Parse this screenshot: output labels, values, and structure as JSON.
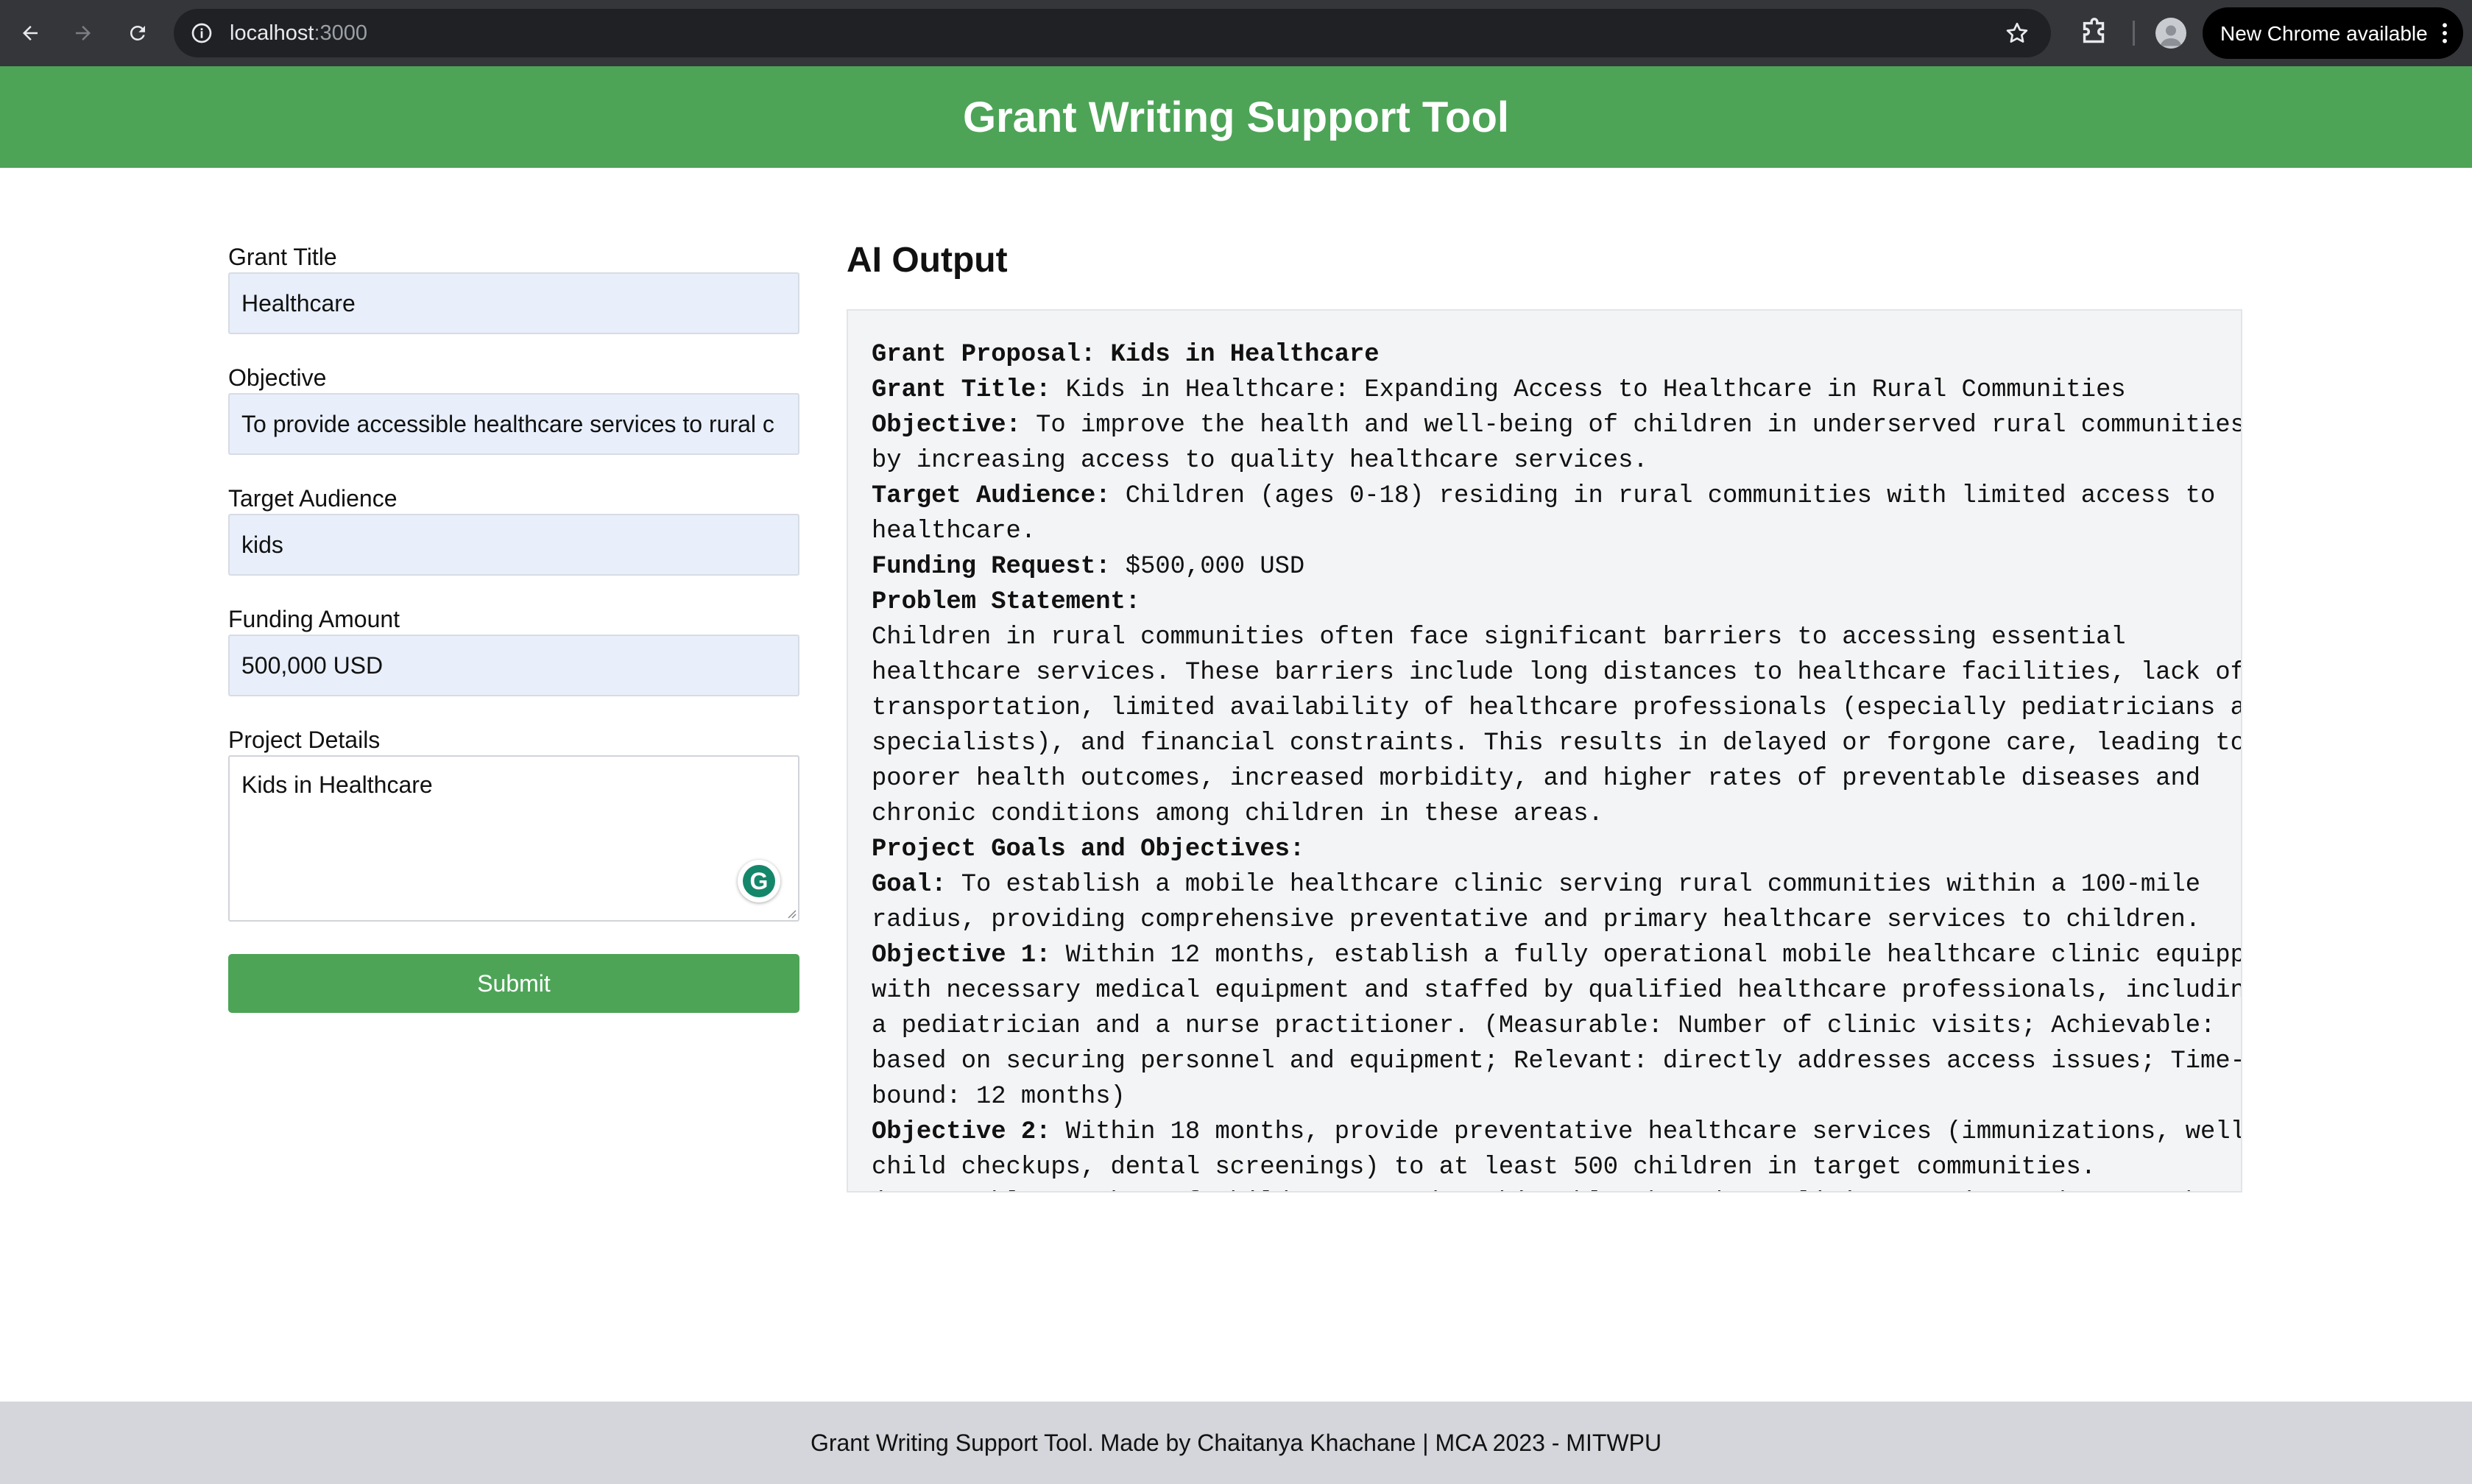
{
  "browser": {
    "url_host": "localhost",
    "url_port": ":3000",
    "update_label": "New Chrome available"
  },
  "header": {
    "title": "Grant Writing Support Tool"
  },
  "form": {
    "grant_title_label": "Grant Title",
    "grant_title_value": "Healthcare",
    "objective_label": "Objective",
    "objective_value": "To provide accessible healthcare services to rural c",
    "target_audience_label": "Target Audience",
    "target_audience_value": "kids",
    "funding_amount_label": "Funding Amount",
    "funding_amount_value": "500,000 USD",
    "project_details_label": "Project Details",
    "project_details_value": "Kids in Healthcare",
    "grammarly_glyph": "G",
    "submit_label": "Submit"
  },
  "output": {
    "title": "AI Output",
    "lines": [
      {
        "bold": "Grant Proposal: Kids in Healthcare",
        "text": ""
      },
      {
        "bold": "Grant Title:",
        "text": " Kids in Healthcare: Expanding Access to Healthcare in Rural Communities"
      },
      {
        "bold": "Objective:",
        "text": " To improve the health and well-being of children in underserved rural communities"
      },
      {
        "bold": "",
        "text": "by increasing access to quality healthcare services."
      },
      {
        "bold": "Target Audience:",
        "text": " Children (ages 0-18) residing in rural communities with limited access to"
      },
      {
        "bold": "",
        "text": "healthcare."
      },
      {
        "bold": "Funding Request:",
        "text": " $500,000 USD"
      },
      {
        "bold": "Problem Statement:",
        "text": ""
      },
      {
        "bold": "",
        "text": "Children in rural communities often face significant barriers to accessing essential"
      },
      {
        "bold": "",
        "text": "healthcare services. These barriers include long distances to healthcare facilities, lack of"
      },
      {
        "bold": "",
        "text": "transportation, limited availability of healthcare professionals (especially pediatricians and"
      },
      {
        "bold": "",
        "text": "specialists), and financial constraints. This results in delayed or forgone care, leading to"
      },
      {
        "bold": "",
        "text": "poorer health outcomes, increased morbidity, and higher rates of preventable diseases and"
      },
      {
        "bold": "",
        "text": "chronic conditions among children in these areas."
      },
      {
        "bold": "Project Goals and Objectives:",
        "text": ""
      },
      {
        "bold": "Goal:",
        "text": " To establish a mobile healthcare clinic serving rural communities within a 100-mile"
      },
      {
        "bold": "",
        "text": "radius, providing comprehensive preventative and primary healthcare services to children."
      },
      {
        "bold": "Objective 1:",
        "text": " Within 12 months, establish a fully operational mobile healthcare clinic equipped"
      },
      {
        "bold": "",
        "text": "with necessary medical equipment and staffed by qualified healthcare professionals, including"
      },
      {
        "bold": "",
        "text": "a pediatrician and a nurse practitioner. (Measurable: Number of clinic visits; Achievable:"
      },
      {
        "bold": "",
        "text": "based on securing personnel and equipment; Relevant: directly addresses access issues; Time-"
      },
      {
        "bold": "",
        "text": "bound: 12 months)"
      },
      {
        "bold": "Objective 2:",
        "text": " Within 18 months, provide preventative healthcare services (immunizations, well-"
      },
      {
        "bold": "",
        "text": "child checkups, dental screenings) to at least 500 children in target communities."
      },
      {
        "bold": "",
        "text": "(Measurable: Number of children served; Achievable: based on clinic capacity and outreach;"
      }
    ]
  },
  "footer": {
    "text": "Grant Writing Support Tool. Made by Chaitanya Khachane | MCA 2023 - MITWPU"
  }
}
